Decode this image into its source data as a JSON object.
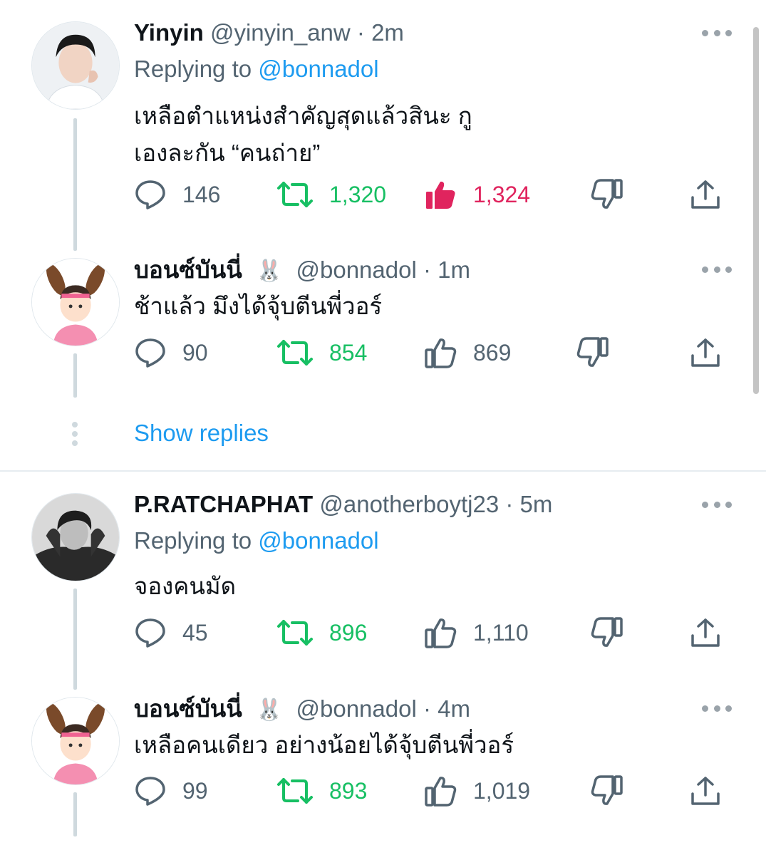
{
  "tweets": [
    {
      "name": "Yinyin",
      "handle": "@yinyin_anw",
      "sep": "·",
      "time": "2m",
      "replying_prefix": "Replying to",
      "replying_to": "@bonnadol",
      "text_line1": "เหลือตำแหน่งสำคัญสุดแล้วสินะ กู",
      "text_line2": "เองละกัน “คนถ่าย”",
      "replies": "146",
      "retweets": "1,320",
      "likes": "1,324",
      "liked": true
    },
    {
      "name": "บอนซ์บันนี่",
      "emoji": "🐰",
      "handle": "@bonnadol",
      "sep": "·",
      "time": "1m",
      "text_line1": "ช้าแล้ว มึงได้จุ้บตีนพี่วอร์",
      "replies": "90",
      "retweets": "854",
      "likes": "869"
    },
    {
      "name": "P.RATCHAPHAT",
      "handle": "@anotherboytj23",
      "sep": "·",
      "time": "5m",
      "replying_prefix": "Replying to",
      "replying_to": "@bonnadol",
      "text_line1": "จองคนมัด",
      "replies": "45",
      "retweets": "896",
      "likes": "1,110"
    },
    {
      "name": "บอนซ์บันนี่",
      "emoji": "🐰",
      "handle": "@bonnadol",
      "sep": "·",
      "time": "4m",
      "text_line1": "เหลือคนเดียว อย่างน้อยได้จุ้บตีนพี่วอร์",
      "replies": "99",
      "retweets": "893",
      "likes": "1,019"
    }
  ],
  "show_replies": "Show replies",
  "colors": {
    "text": "#0f1419",
    "secondary": "#536471",
    "link": "#1d9bf0",
    "retweet": "#17bf63",
    "like": "#e0245e"
  }
}
